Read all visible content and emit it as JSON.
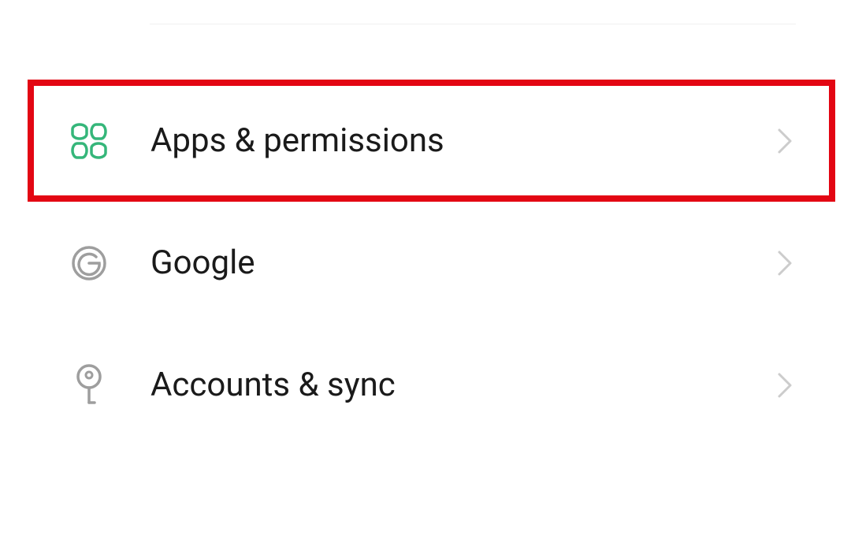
{
  "settings": {
    "items": [
      {
        "label": "Apps & permissions",
        "icon": "apps-icon",
        "highlighted": true
      },
      {
        "label": "Google",
        "icon": "google-icon",
        "highlighted": false
      },
      {
        "label": "Accounts & sync",
        "icon": "key-icon",
        "highlighted": false
      }
    ]
  },
  "colors": {
    "highlight_border": "#e30613",
    "icon_green": "#35b67a",
    "icon_gray": "#9e9e9e",
    "chevron": "#cccccc"
  }
}
